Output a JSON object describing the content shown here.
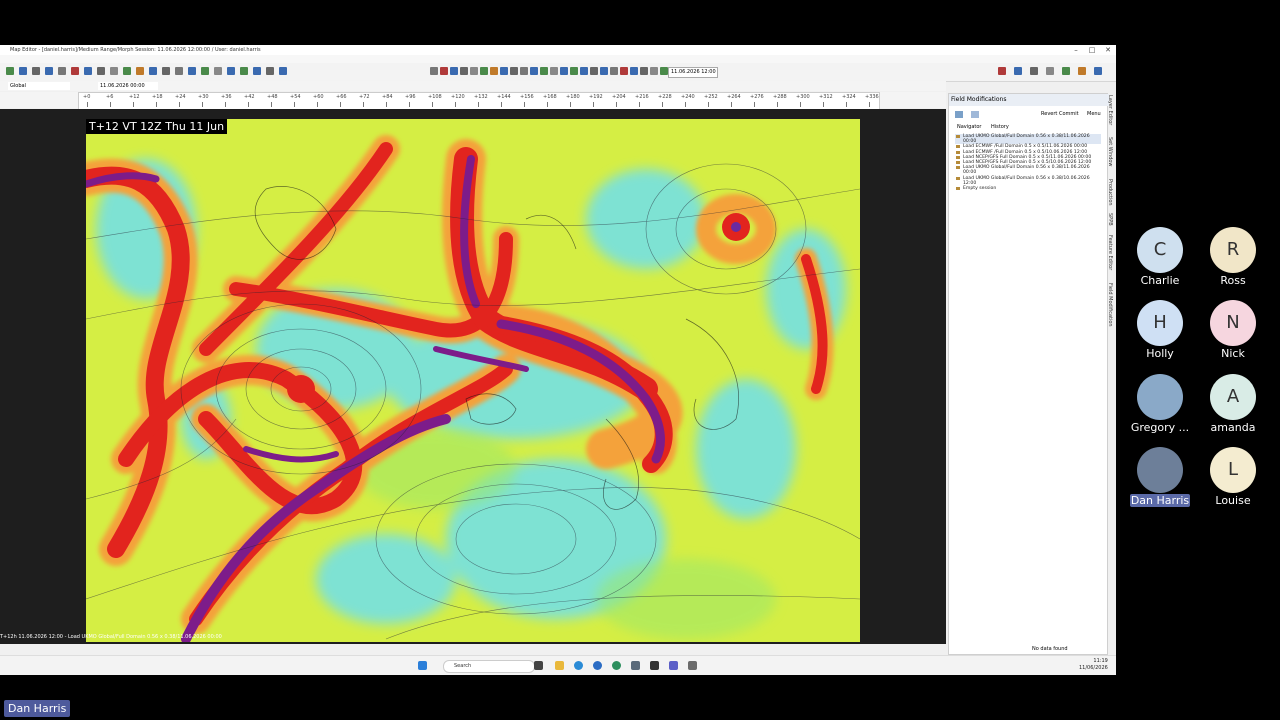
{
  "window": {
    "title": "Map Editor - [daniel.harris]/Medium Range/Morph Session: 11.06.2026 12:00:00 / User: daniel.harris",
    "min": "–",
    "max": "□",
    "close": "✕"
  },
  "toolbar": {
    "date_value": "11.06.2026 12:00"
  },
  "row2": {
    "domain": "Global",
    "time": "11.06.2026 00:00"
  },
  "timeline": {
    "ticks": [
      "+0",
      "+6",
      "+12",
      "+18",
      "+24",
      "+30",
      "+36",
      "+42",
      "+48",
      "+54",
      "+60",
      "+66",
      "+72",
      "+84",
      "+96",
      "+108",
      "+120",
      "+132",
      "+144",
      "+156",
      "+168",
      "+180",
      "+192",
      "+204",
      "+216",
      "+228",
      "+240",
      "+252",
      "+264",
      "+276",
      "+288",
      "+300",
      "+312",
      "+324",
      "+336"
    ]
  },
  "map": {
    "label": "T+12 VT 12Z Thu 11 Jun",
    "footer": "T+12h 11.06.2026 12:00 - Load UKMO Global/Full Domain 0.56 x 0.38/11.06.2026 00:00"
  },
  "panel": {
    "title": "Field Modifications",
    "revert": "Revert",
    "commit": "Commit",
    "menu": "Menu",
    "tabs": [
      "Navigator",
      "History"
    ],
    "history": [
      "Load UKMO Global/Full Domain 0.56 x 0.38/11.06.2026 00:00",
      "Load ECMWF /Full Domain 0.5 x 0.5/11.06.2026 00:00",
      "Load ECMWF /Full Domain 0.5 x 0.5/10.06.2026 12:00",
      "Load NCEP/GFS Full Domain 0.5 x 0.5/11.06.2026 00:00",
      "Load NCEP/GFS Full Domain 0.5 x 0.5/10.06.2026 12:00",
      "Load UKMO Global/Full Domain 0.56 x 0.38/11.06.2026 00:00",
      "Load UKMO Global/Full Domain 0.56 x 0.38/10.06.2026 12:00",
      "Empty session"
    ],
    "status": "No data found"
  },
  "side_tabs": [
    "Layer Editor",
    "Set Window",
    "Production",
    "SPPB",
    "Feature Editor",
    "Field Modification"
  ],
  "taskbar": {
    "search": "Search",
    "time": "11:19",
    "date": "11/06/2026"
  },
  "participants": [
    {
      "initial": "C",
      "name": "Charlie",
      "color": "#cfe0ef"
    },
    {
      "initial": "R",
      "name": "Ross",
      "color": "#f1e6c8"
    },
    {
      "initial": "H",
      "name": "Holly",
      "color": "#cfe0f4"
    },
    {
      "initial": "N",
      "name": "Nick",
      "color": "#f6d6df"
    },
    {
      "initial": "",
      "name": "Gregory ...",
      "color": "#8aa9c8"
    },
    {
      "initial": "A",
      "name": "amanda",
      "color": "#d9ece6"
    },
    {
      "initial": "",
      "name": "Dan Harris",
      "color": "#6d7f99"
    },
    {
      "initial": "L",
      "name": "Louise",
      "color": "#f4ecd0"
    }
  ],
  "speaker": "Dan Harris"
}
